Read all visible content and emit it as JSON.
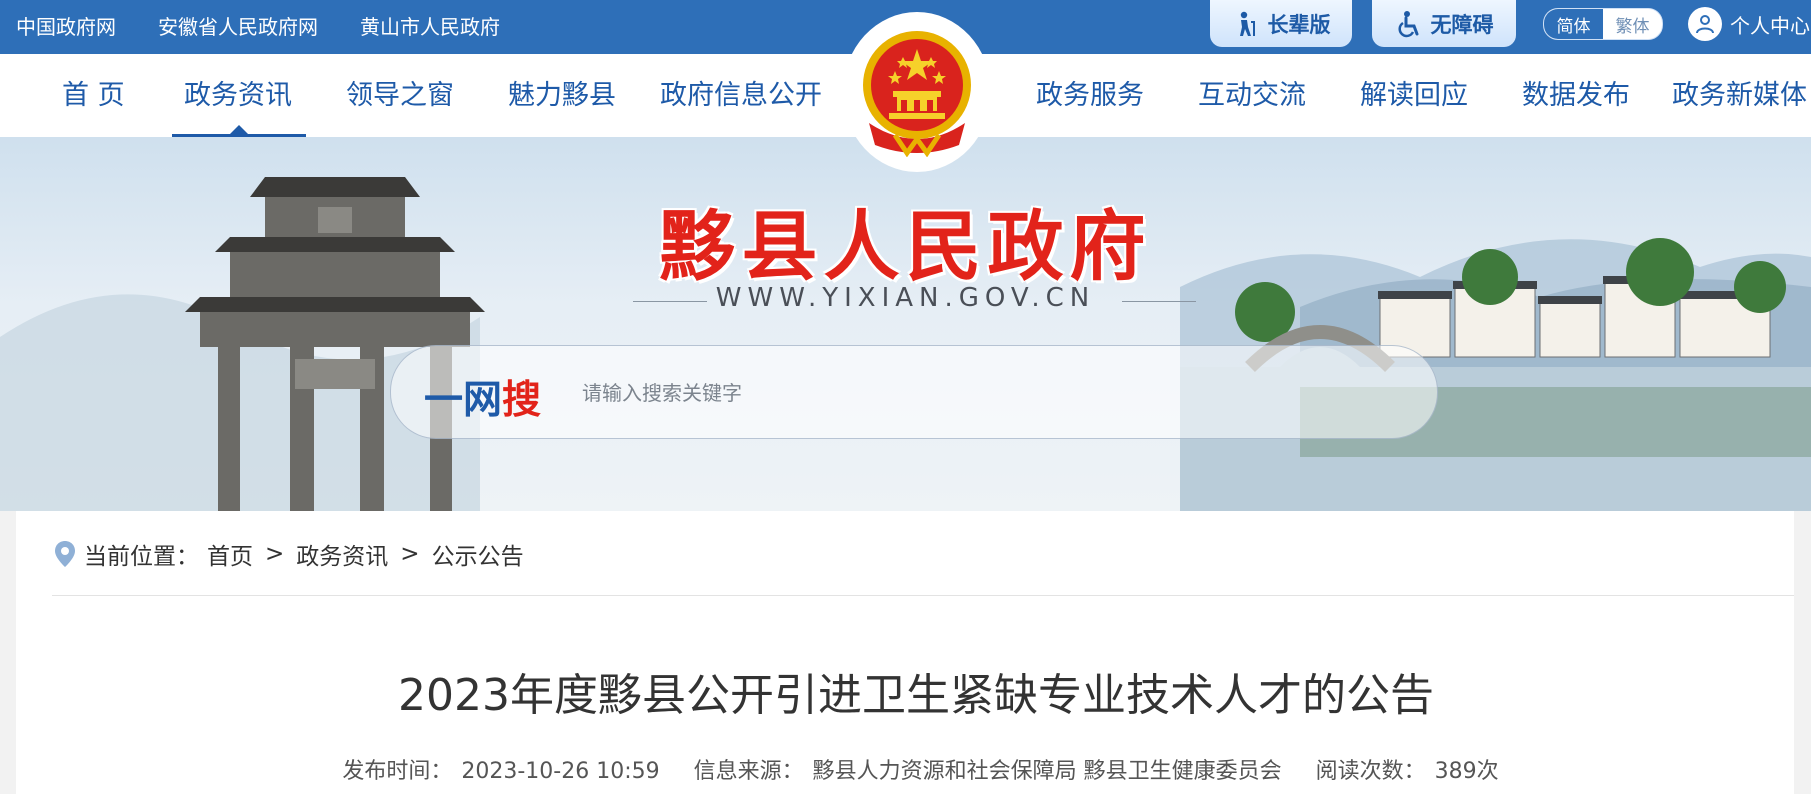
{
  "topbar": {
    "links": [
      "中国政府网",
      "安徽省人民政府网",
      "黄山市人民政府"
    ],
    "elder_label": "长辈版",
    "access_label": "无障碍",
    "lang_simplified": "简体",
    "lang_traditional": "繁体",
    "user_center": "个人中心",
    "bg_color": "#2e6fb8"
  },
  "nav": {
    "items": [
      "首 页",
      "政务资讯",
      "领导之窗",
      "魅力黟县",
      "政府信息公开",
      "政务服务",
      "互动交流",
      "解读回应",
      "数据发布",
      "政务新媒体"
    ],
    "active": "政务资讯"
  },
  "banner": {
    "site_title": "黟县人民政府",
    "site_url": "WWW.YIXIAN.GOV.CN",
    "search_label_blue": "一网",
    "search_label_red": "搜",
    "search_placeholder": "请输入搜索关键字"
  },
  "breadcrumb": {
    "prefix": "当前位置：",
    "items": [
      "首页",
      "政务资讯",
      "公示公告"
    ],
    "separator": ">"
  },
  "article": {
    "title": "2023年度黟县公开引进卫生紧缺专业技术人才的公告",
    "publish_time_label": "发布时间：",
    "publish_time": "2023-10-26 10:59",
    "source_label": "信息来源：",
    "source": "黟县人力资源和社会保障局 黟县卫生健康委员会",
    "views_label": "阅读次数：",
    "views": "389次"
  },
  "icons": {
    "elder": "elder-person-icon",
    "access": "wheelchair-icon",
    "user": "user-icon",
    "location": "location-pin-icon",
    "emblem": "national-emblem-icon"
  }
}
